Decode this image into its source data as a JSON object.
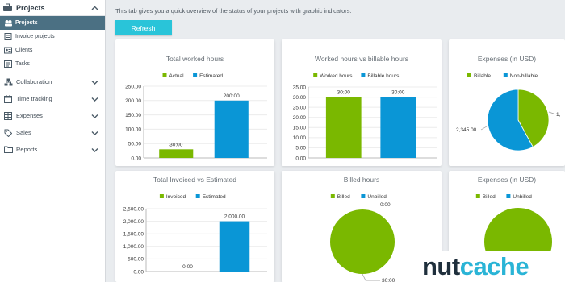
{
  "sidebar": {
    "section_title": "Projects",
    "sub_items": [
      {
        "label": "Projects",
        "icon": "projects-icon",
        "active": true
      },
      {
        "label": "Invoice projects",
        "icon": "invoice-icon",
        "active": false
      },
      {
        "label": "Clients",
        "icon": "clients-icon",
        "active": false
      },
      {
        "label": "Tasks",
        "icon": "tasks-icon",
        "active": false
      }
    ],
    "items": [
      {
        "label": "Collaboration",
        "icon": "collaboration-icon"
      },
      {
        "label": "Time tracking",
        "icon": "calendar-icon"
      },
      {
        "label": "Expenses",
        "icon": "expenses-icon"
      },
      {
        "label": "Sales",
        "icon": "tag-icon"
      },
      {
        "label": "Reports",
        "icon": "folder-icon"
      }
    ]
  },
  "main": {
    "description": "This tab gives you a quick overview of the status of your projects with graphic indicators.",
    "refresh_label": "Refresh"
  },
  "colors": {
    "green": "#7ab800",
    "blue": "#0a96d6",
    "accent": "#29c4d9",
    "sidebar_active": "#4b7083"
  },
  "chart_data": [
    {
      "type": "bar",
      "title": "Total worked hours",
      "series": [
        {
          "name": "Actual",
          "values": [
            30
          ]
        },
        {
          "name": "Estimated",
          "values": [
            200
          ]
        }
      ],
      "data_labels": [
        "30:00",
        "200:00"
      ],
      "ylim": [
        0,
        250
      ],
      "yticks": [
        "0.00",
        "50.00",
        "100.00",
        "150.00",
        "200.00",
        "250.00"
      ]
    },
    {
      "type": "bar",
      "title": "Worked hours vs billable hours",
      "series": [
        {
          "name": "Worked hours",
          "values": [
            30
          ]
        },
        {
          "name": "Billable hours",
          "values": [
            30
          ]
        }
      ],
      "data_labels": [
        "30:00",
        "30:00"
      ],
      "ylim": [
        0,
        35
      ],
      "yticks": [
        "0.00",
        "5.00",
        "10.00",
        "15.00",
        "20.00",
        "25.00",
        "30.00",
        "35.00"
      ]
    },
    {
      "type": "pie",
      "title": "Expenses (in USD)",
      "series": [
        {
          "name": "Billable",
          "values": [
            1700
          ]
        },
        {
          "name": "Non-billable",
          "values": [
            2345
          ]
        }
      ],
      "slice_labels": [
        "1,",
        "2,345.00"
      ]
    },
    {
      "type": "bar",
      "title": "Total Invoiced vs Estimated",
      "series": [
        {
          "name": "Invoiced",
          "values": [
            0
          ]
        },
        {
          "name": "Estimated",
          "values": [
            2000
          ]
        }
      ],
      "data_labels": [
        "0.00",
        "2,000.00"
      ],
      "ylim": [
        0,
        2500
      ],
      "yticks": [
        "0.00",
        "500.00",
        "1,000.00",
        "1,500.00",
        "2,000.00",
        "2,500.00"
      ]
    },
    {
      "type": "pie",
      "title": "Billed hours",
      "series": [
        {
          "name": "Billed",
          "values": [
            30
          ]
        },
        {
          "name": "Unbilled",
          "values": [
            0
          ]
        }
      ],
      "slice_labels": [
        "30:00",
        "0:00"
      ]
    },
    {
      "type": "pie",
      "title": "Expenses (in USD)",
      "series": [
        {
          "name": "Billed",
          "values": [
            100
          ]
        },
        {
          "name": "Unbilled",
          "values": [
            0
          ]
        }
      ],
      "slice_labels": []
    }
  ],
  "brand": {
    "logo_part1": "nut",
    "logo_part2": "cache"
  }
}
